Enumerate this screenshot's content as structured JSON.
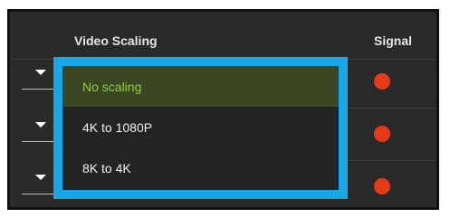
{
  "table": {
    "columns": {
      "video_scaling": "Video Scaling",
      "signal": "Signal"
    },
    "rows_signal_status": [
      "red",
      "red",
      "red"
    ]
  },
  "dropdown": {
    "options": [
      {
        "label": "No scaling",
        "selected": true
      },
      {
        "label": "4K to 1080P",
        "selected": false
      },
      {
        "label": "8K to 4K",
        "selected": false
      }
    ]
  },
  "colors": {
    "highlight_border": "#18a6e6",
    "selected_bg": "#3b4722",
    "selected_text": "#8dcc45",
    "signal_red": "#e63a18",
    "panel_bg": "#2a2a2a"
  },
  "icons": {
    "row_dropdown": "caret-down-icon",
    "signal": "status-dot-icon"
  }
}
